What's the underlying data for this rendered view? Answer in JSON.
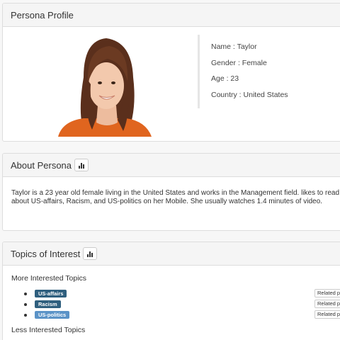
{
  "profile": {
    "title": "Persona Profile",
    "name": "Name : Taylor",
    "gender": "Gender : Female",
    "age": "Age : 23",
    "country": "Country : United States"
  },
  "about": {
    "title": "About Persona",
    "text": "Taylor is a 23 year old female living in the United States and works in the Management field. likes to read about US-affairs, Racism, and US-politics on her Mobile. She usually watches 1.4 minutes of video."
  },
  "topics": {
    "title": "Topics of Interest",
    "more_label": "More Interested Topics",
    "less_label": "Less Interested Topics",
    "items": [
      {
        "tag": "US-affairs",
        "color": "#2f5f7e",
        "related": "Related p"
      },
      {
        "tag": "Racism",
        "color": "#2f5f7e",
        "related": "Related p"
      },
      {
        "tag": "US-politics",
        "color": "#5b93c7",
        "related": "Related p"
      }
    ]
  },
  "icons": {
    "chart": "bar-chart-icon"
  }
}
